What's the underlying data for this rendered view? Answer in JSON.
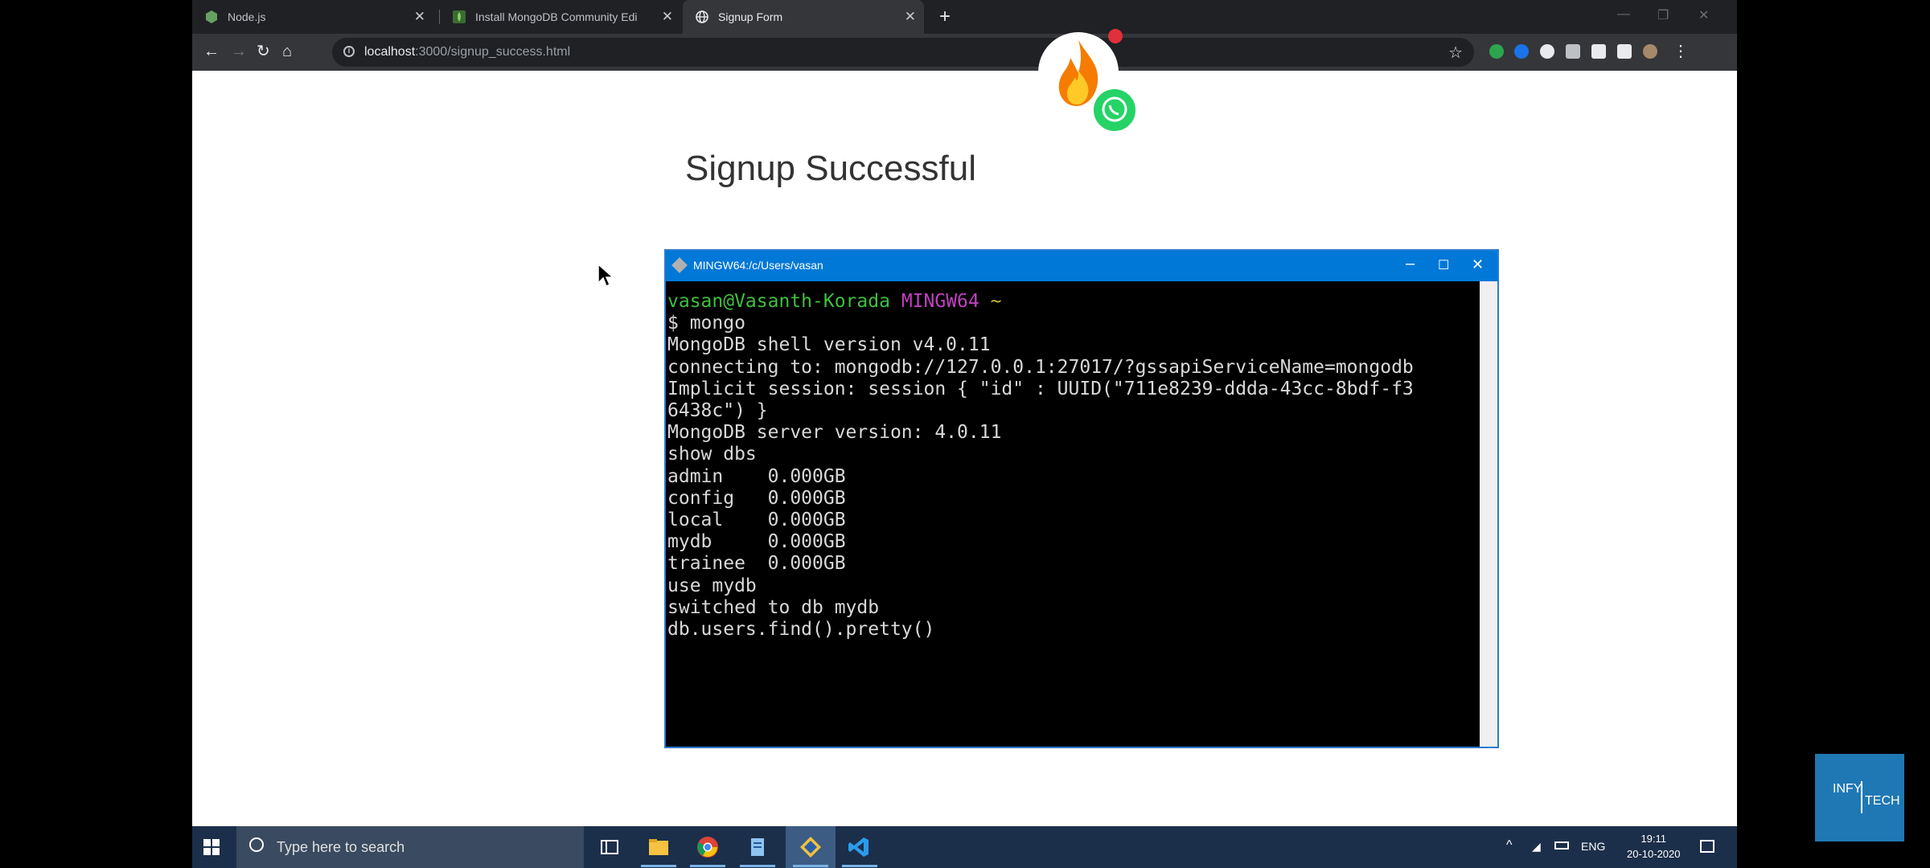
{
  "browser": {
    "tabs": [
      {
        "label": "Node.js",
        "favicon": "nodejs-icon",
        "active": false
      },
      {
        "label": "Install MongoDB Community Edi",
        "favicon": "mongodb-leaf-icon",
        "active": false
      },
      {
        "label": "Signup Form",
        "favicon": "globe-icon",
        "active": true
      }
    ],
    "url_host": "localhost",
    "url_path": ":3000/signup_success.html"
  },
  "page": {
    "title": "Signup Successful"
  },
  "terminal": {
    "title": "MINGW64:/c/Users/vasan",
    "prompt_user": "vasan@Vasanth-Korada",
    "prompt_env": "MINGW64",
    "prompt_dir": "~",
    "lines": [
      "$ mongo",
      "MongoDB shell version v4.0.11",
      "connecting to: mongodb://127.0.0.1:27017/?gssapiServiceName=mongodb",
      "Implicit session: session { \"id\" : UUID(\"711e8239-ddda-43cc-8bdf-f3",
      "6438c\") }",
      "MongoDB server version: 4.0.11",
      "show dbs",
      "admin    0.000GB",
      "config   0.000GB",
      "local    0.000GB",
      "mydb     0.000GB",
      "trainee  0.000GB",
      "use mydb",
      "switched to db mydb",
      "db.users.find().pretty()"
    ]
  },
  "taskbar": {
    "search_placeholder": "Type here to search",
    "language": "ENG",
    "time": "19:11",
    "date": "20-10-2020"
  },
  "watermark": {
    "line1": "INFY",
    "line2": "TECH"
  },
  "colors": {
    "terminal_titlebar": "#0078d7",
    "prompt_user": "#3fbf3f",
    "prompt_env": "#c040c0",
    "taskbar": "#1c2f4a",
    "watermark": "#1f78b4"
  }
}
